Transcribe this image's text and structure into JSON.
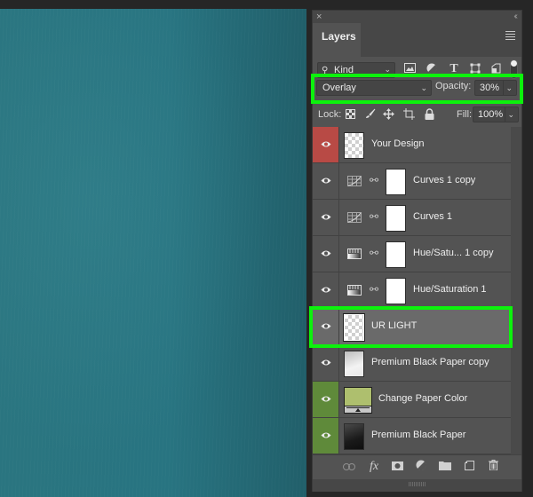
{
  "canvas": {
    "color": "#287481",
    "description": "teal paper texture"
  },
  "panel": {
    "title": "Layers",
    "close_icon": "×",
    "collapse_icon": "‹‹",
    "menu_icon": "hamburger-menu-icon"
  },
  "filter": {
    "kind_label": "Kind",
    "icons": [
      "image-filter-icon",
      "adjustment-filter-icon",
      "type-filter-icon",
      "shape-filter-icon",
      "smart-object-filter-icon"
    ],
    "toggle_on": true
  },
  "blend": {
    "mode": "Overlay",
    "opacity_label": "Opacity:",
    "opacity_value": "30%",
    "highlight_color": "#0cf20c"
  },
  "lock": {
    "label": "Lock:",
    "icons": [
      "lock-transparent-pixels-icon",
      "lock-image-pixels-icon",
      "lock-position-icon",
      "lock-artboard-icon",
      "lock-all-icon"
    ],
    "fill_label": "Fill:",
    "fill_value": "100%"
  },
  "layers": [
    {
      "name": "Your Design",
      "type": "pixel",
      "thumb": "transparent",
      "eye_color": "#b84a45",
      "visible": true
    },
    {
      "name": "Curves 1 copy",
      "type": "curves",
      "thumb": "mask",
      "eye_color": "",
      "visible": true
    },
    {
      "name": "Curves 1",
      "type": "curves",
      "thumb": "mask",
      "eye_color": "",
      "visible": true
    },
    {
      "name": "Hue/Satu... 1 copy",
      "type": "hue-saturation",
      "thumb": "mask",
      "eye_color": "",
      "visible": true
    },
    {
      "name": "Hue/Saturation 1",
      "type": "hue-saturation",
      "thumb": "mask",
      "eye_color": "",
      "visible": true
    },
    {
      "name": "UR LIGHT",
      "type": "pixel",
      "thumb": "transparent",
      "eye_color": "",
      "visible": true,
      "selected": true
    },
    {
      "name": "Premium Black Paper copy",
      "type": "pixel",
      "thumb": "light-gradient",
      "eye_color": "",
      "visible": true
    },
    {
      "name": "Change Paper Color",
      "type": "solid-fill",
      "thumb": "fill",
      "fill_color": "#aebf6e",
      "eye_color": "#5f8a3a",
      "visible": true
    },
    {
      "name": "Premium Black Paper",
      "type": "pixel",
      "thumb": "dark-gradient",
      "eye_color": "#5f8a3a",
      "visible": true
    }
  ],
  "bottom_bar": {
    "icons": [
      "link-layers-icon",
      "fx-icon",
      "add-mask-icon",
      "adjustment-layer-icon",
      "new-group-icon",
      "new-layer-icon",
      "delete-icon"
    ],
    "fx_label": "fx"
  }
}
